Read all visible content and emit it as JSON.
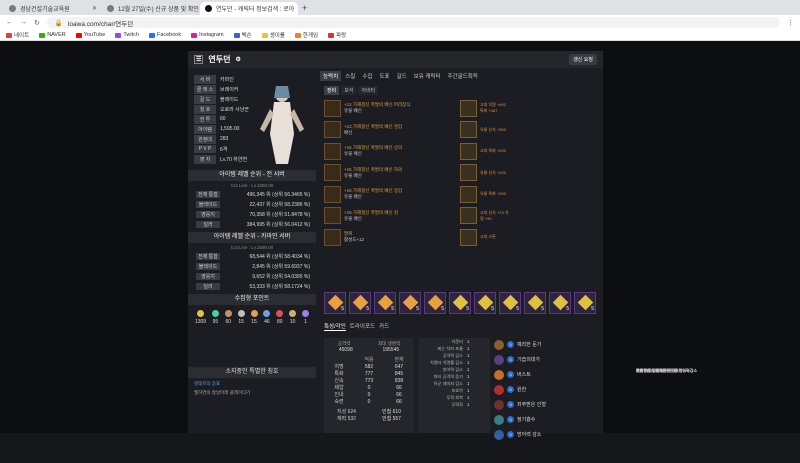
{
  "browser": {
    "tabs": [
      {
        "title": "경남건설기술교육원",
        "active": false
      },
      {
        "title": "12월 27일(수) 신규 상품 및 확인",
        "active": false
      },
      {
        "title": "연두던 - 캐릭터 정보검색 : 로아",
        "active": true
      }
    ],
    "url": "loawa.com/char/연두던",
    "bookmarks": [
      "네이트",
      "NAVER",
      "YouTube",
      "Twitch",
      "Facebook",
      "Instagram",
      "백슨",
      "생이룰",
      "한게임",
      "파랑"
    ]
  },
  "character": {
    "name": "연두던",
    "update_button": "갱신 요청",
    "info": [
      {
        "k": "서 버",
        "v": "카마인"
      },
      {
        "k": "클 래 스",
        "v": "브레이커"
      },
      {
        "k": "길 드",
        "v": "블레이드"
      },
      {
        "k": "칭 호",
        "v": "오로라 사냥꾼"
      },
      {
        "k": "전 투",
        "v": "60"
      },
      {
        "k": "아이템",
        "v": "1,595.00"
      },
      {
        "k": "원정대",
        "v": "283"
      },
      {
        "k": "P V P",
        "v": "6격"
      },
      {
        "k": "영 지",
        "v": "Lv.70 하얀연"
      }
    ]
  },
  "ranking_all": {
    "title": "아이템 레벨 순위 - 전 서버",
    "cut": "Cut Line : Lv.1590.00",
    "rows": [
      {
        "label": "전체 통합",
        "value": "496,345 위 (상위 56.3465 %)"
      },
      {
        "label": "블레이드",
        "value": "22,437 위 (상위 58.2386 %)"
      },
      {
        "label": "영웅지",
        "value": "70,358 위 (상위 51.8478 %)"
      },
      {
        "label": "딜러",
        "value": "384,995 위 (상위 56.0412 %)"
      }
    ]
  },
  "ranking_server": {
    "title": "아이템 레벨 순위 - 카마인 서버",
    "cut": "Cut Line : Lv.1590.00",
    "rows": [
      {
        "label": "전체 통합",
        "value": "68,544 위 (상위 58.4034 %)"
      },
      {
        "label": "블레이드",
        "value": "2,845 위 (상위 59.6937 %)"
      },
      {
        "label": "영웅지",
        "value": "9,652 위 (상위 54.0395 %)"
      },
      {
        "label": "딜러",
        "value": "53,333 위 (상위 58.1724 %)"
      }
    ]
  },
  "collection": {
    "title": "수집형 포인트",
    "items": [
      {
        "value": "1309",
        "color": "#e8c040"
      },
      {
        "value": "95",
        "color": "#4ad0a0"
      },
      {
        "value": "60",
        "color": "#c89060"
      },
      {
        "value": "15",
        "color": "#c0c0c0"
      },
      {
        "value": "15",
        "color": "#e0a050"
      },
      {
        "value": "46",
        "color": "#6aa0e0"
      },
      {
        "value": "80",
        "color": "#e05050"
      },
      {
        "value": "10",
        "color": "#d0b070"
      },
      {
        "value": "1",
        "color": "#a080e0"
      }
    ]
  },
  "guild": {
    "title": "소지중인 특별한 칭호",
    "lines": [
      "힐레르의 증표",
      "월하연의 칼날아래 클레이디기"
    ]
  },
  "main_tabs": [
    "능력치",
    "스킬",
    "수집",
    "도표",
    "길드",
    "보유 캐릭터",
    "주간골드획득"
  ],
  "sub_tabs": [
    "장비",
    "보석",
    "아바타"
  ],
  "equipment": [
    {
      "name": "+12 가해갱신 폭발의 배신 머리장식",
      "q": "유물 배신"
    },
    {
      "name": "+12 가해갱신 폭발의 배신 견갑",
      "q": "배신"
    },
    {
      "name": "+15 가해갱신 폭발의 배신 상의",
      "q": "유물 배신"
    },
    {
      "name": "+15 가해갱신 폭발의 배신 하의",
      "q": "유물 배신"
    },
    {
      "name": "+15 가해갱신 폭발의 배신 장갑",
      "q": "유물 배신"
    },
    {
      "name": "+15 가해갱신 폭발의 배신 검",
      "q": "유물 배신"
    },
    {
      "name": "팔찌",
      "q": "활성도+12"
    }
  ],
  "accessories": [
    {
      "col": "고대 치명 +492 특화 +487",
      "eng": "기습의대가 저주받은인형 방어력감소"
    },
    {
      "col": "유물 신속 +300",
      "eng": "정밀단도 원한 방어력감소"
    },
    {
      "col": "고대 특화 +290",
      "eng": "저주받은인형 예리한둔기 방어력감소"
    },
    {
      "col": "유물 신속 +200",
      "eng": "예리한둔기 전투준비 공격력감소"
    },
    {
      "col": "유물 특화 +200",
      "eng": "정기흡수 급소타격 공격력감소"
    },
    {
      "col": "고대 신속 +73 치명 +90",
      "eng": "원한 속공 이동속도"
    },
    {
      "col": "고대 스톤",
      "eng": "기습의대가 저주받은인형 방어력감소"
    }
  ],
  "bracelet": {
    "label": "버스트",
    "value": "활성도+12"
  },
  "gems": [
    {
      "lv": "5",
      "c": "#e8a040"
    },
    {
      "lv": "5",
      "c": "#e8a040"
    },
    {
      "lv": "5",
      "c": "#e8a040"
    },
    {
      "lv": "5",
      "c": "#e8a040"
    },
    {
      "lv": "5",
      "c": "#e8a040"
    },
    {
      "lv": "5",
      "c": "#e0c040"
    },
    {
      "lv": "5",
      "c": "#e0c040"
    },
    {
      "lv": "5",
      "c": "#e0c040"
    },
    {
      "lv": "5",
      "c": "#e0c040"
    },
    {
      "lv": "5",
      "c": "#e0c040"
    },
    {
      "lv": "5",
      "c": "#e0c040"
    }
  ],
  "bottom_tabs": [
    "특성/각인",
    "트라이포드",
    "카드"
  ],
  "base_stats": {
    "attack_label": "공격력",
    "attack": "45098",
    "hp_label": "최대 생명력",
    "hp": "195545",
    "head": [
      "",
      "적용",
      "현재"
    ],
    "rows": [
      {
        "a": "치명",
        "b": "582",
        "c": "647"
      },
      {
        "a": "특화",
        "b": "777",
        "c": "845"
      },
      {
        "a": "신속",
        "b": "773",
        "c": "838"
      },
      {
        "a": "제압",
        "b": "0",
        "c": "66"
      },
      {
        "a": "인내",
        "b": "0",
        "c": "66"
      },
      {
        "a": "숙련",
        "b": "0",
        "c": "66"
      }
    ],
    "power": "지성 624",
    "power2": "민첩 610",
    "vit": "체력 532",
    "vit2": "민첩 557"
  },
  "mid_stats": [
    {
      "k": "카운터",
      "v": "1"
    },
    {
      "k": "찌는 치떠 포율",
      "v": "1"
    },
    {
      "k": "공격력 감소",
      "v": "1"
    },
    {
      "k": "치명타 치명률 감소",
      "v": "1"
    },
    {
      "k": "방어력 감소",
      "v": "1"
    },
    {
      "k": "파티 공격력 증가",
      "v": "1"
    },
    {
      "k": "아군 데미지 감소",
      "v": "1"
    },
    {
      "k": "보호막",
      "v": "1"
    },
    {
      "k": "무력 회복",
      "v": "1"
    },
    {
      "k": "무력화",
      "v": "1"
    }
  ],
  "engravings": [
    {
      "name": "예리한 둔기",
      "lv": "3",
      "c": "#8a6030"
    },
    {
      "name": "기습의대가",
      "lv": "3",
      "c": "#5a4080"
    },
    {
      "name": "버스트",
      "lv": "3",
      "c": "#c07030"
    },
    {
      "name": "원한",
      "lv": "3",
      "c": "#b03030"
    },
    {
      "name": "저주받은 인형",
      "lv": "3",
      "c": "#703030"
    },
    {
      "name": "정기흡수",
      "lv": "3",
      "c": "#3a8080"
    },
    {
      "name": "방어력 감소",
      "lv": "3",
      "c": "#3060a0"
    }
  ]
}
